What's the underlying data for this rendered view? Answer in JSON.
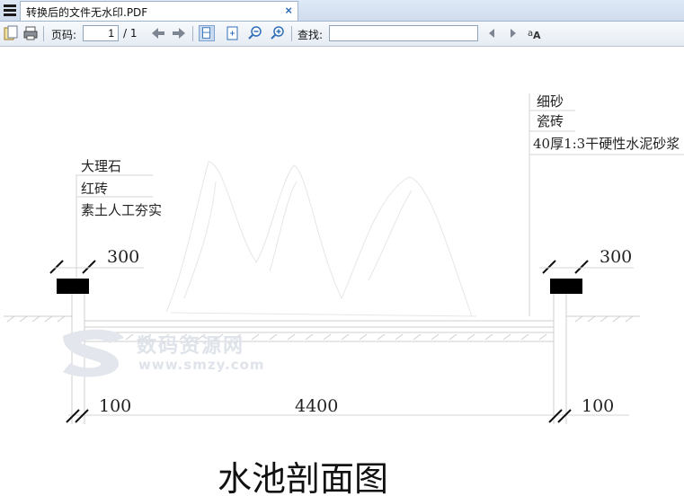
{
  "window": {
    "tab_title": "转换后的文件无水印.PDF",
    "tab_close": "×"
  },
  "toolbar": {
    "page_label": "页码:",
    "page_value": "1",
    "page_total": "/ 1",
    "find_label": "查找:",
    "find_placeholder": ""
  },
  "drawing": {
    "left_layers": [
      "大理石",
      "红砖",
      "素土人工夯实"
    ],
    "right_layers": [
      "细砂",
      "瓷砖",
      "40厚1:3干硬性水泥砂浆"
    ],
    "dim_top_left": "300",
    "dim_top_right": "300",
    "dim_bottom_left": "100",
    "dim_bottom_center": "4400",
    "dim_bottom_right": "100",
    "caption": "水池剖面图"
  },
  "watermark": {
    "logo_text": "数码资源网",
    "url": "www.smzy.com"
  }
}
